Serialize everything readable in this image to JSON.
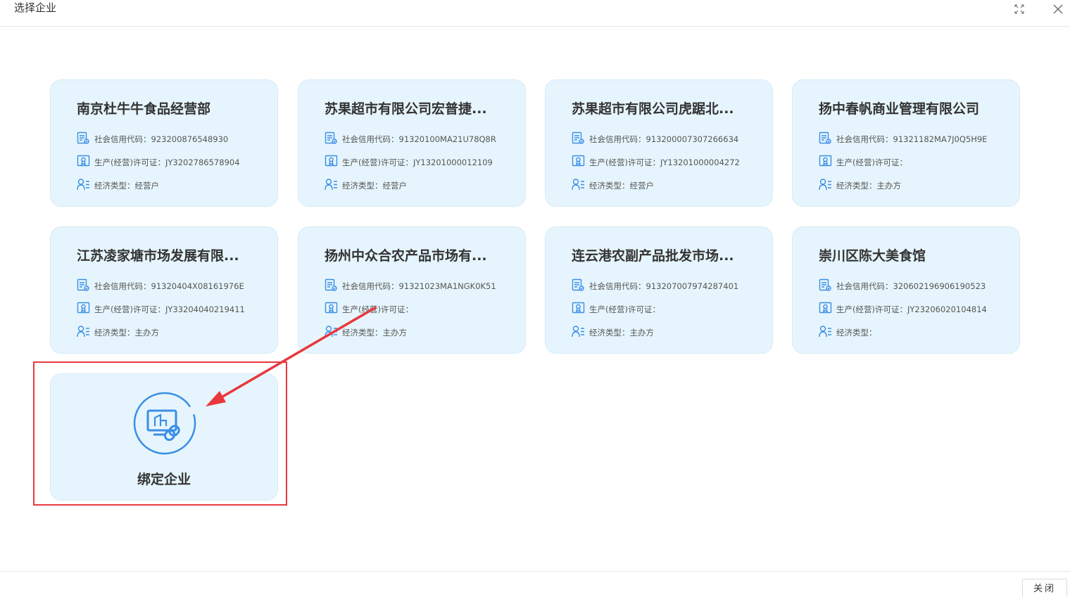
{
  "dialog": {
    "title": "选择企业",
    "close_label": "关闭"
  },
  "labels": {
    "credit_code": "社会信用代码：",
    "license": "生产(经营)许可证：",
    "econ_type": "经济类型："
  },
  "enterprises": [
    {
      "name": "南京杜牛牛食品经营部",
      "credit_code": "923200876548930",
      "license": "JY3202786578904",
      "econ_type": "经营户"
    },
    {
      "name": "苏果超市有限公司宏普捷...",
      "credit_code": "91320100MA21U78Q8R",
      "license": "JY13201000012109",
      "econ_type": "经营户"
    },
    {
      "name": "苏果超市有限公司虎踞北...",
      "credit_code": "913200007307266634",
      "license": "JY13201000004272",
      "econ_type": "经营户"
    },
    {
      "name": "扬中春帆商业管理有限公司",
      "credit_code": "91321182MA7J0Q5H9E",
      "license": "",
      "econ_type": "主办方"
    },
    {
      "name": "江苏凌家塘市场发展有限...",
      "credit_code": "91320404X08161976E",
      "license": "JY33204040219411",
      "econ_type": "主办方"
    },
    {
      "name": "扬州中众合农产品市场有...",
      "credit_code": "91321023MA1NGK0K51",
      "license": "",
      "econ_type": "主办方"
    },
    {
      "name": "连云港农副产品批发市场...",
      "credit_code": "913207007974287401",
      "license": "",
      "econ_type": "主办方"
    },
    {
      "name": "崇川区陈大美食馆",
      "credit_code": "320602196906190523",
      "license": "JY23206020104814",
      "econ_type": ""
    }
  ],
  "bind": {
    "label": "绑定企业"
  },
  "colors": {
    "accent": "#3a8ee6",
    "card_bg": "#e6f5fd",
    "highlight": "#e8383d"
  }
}
